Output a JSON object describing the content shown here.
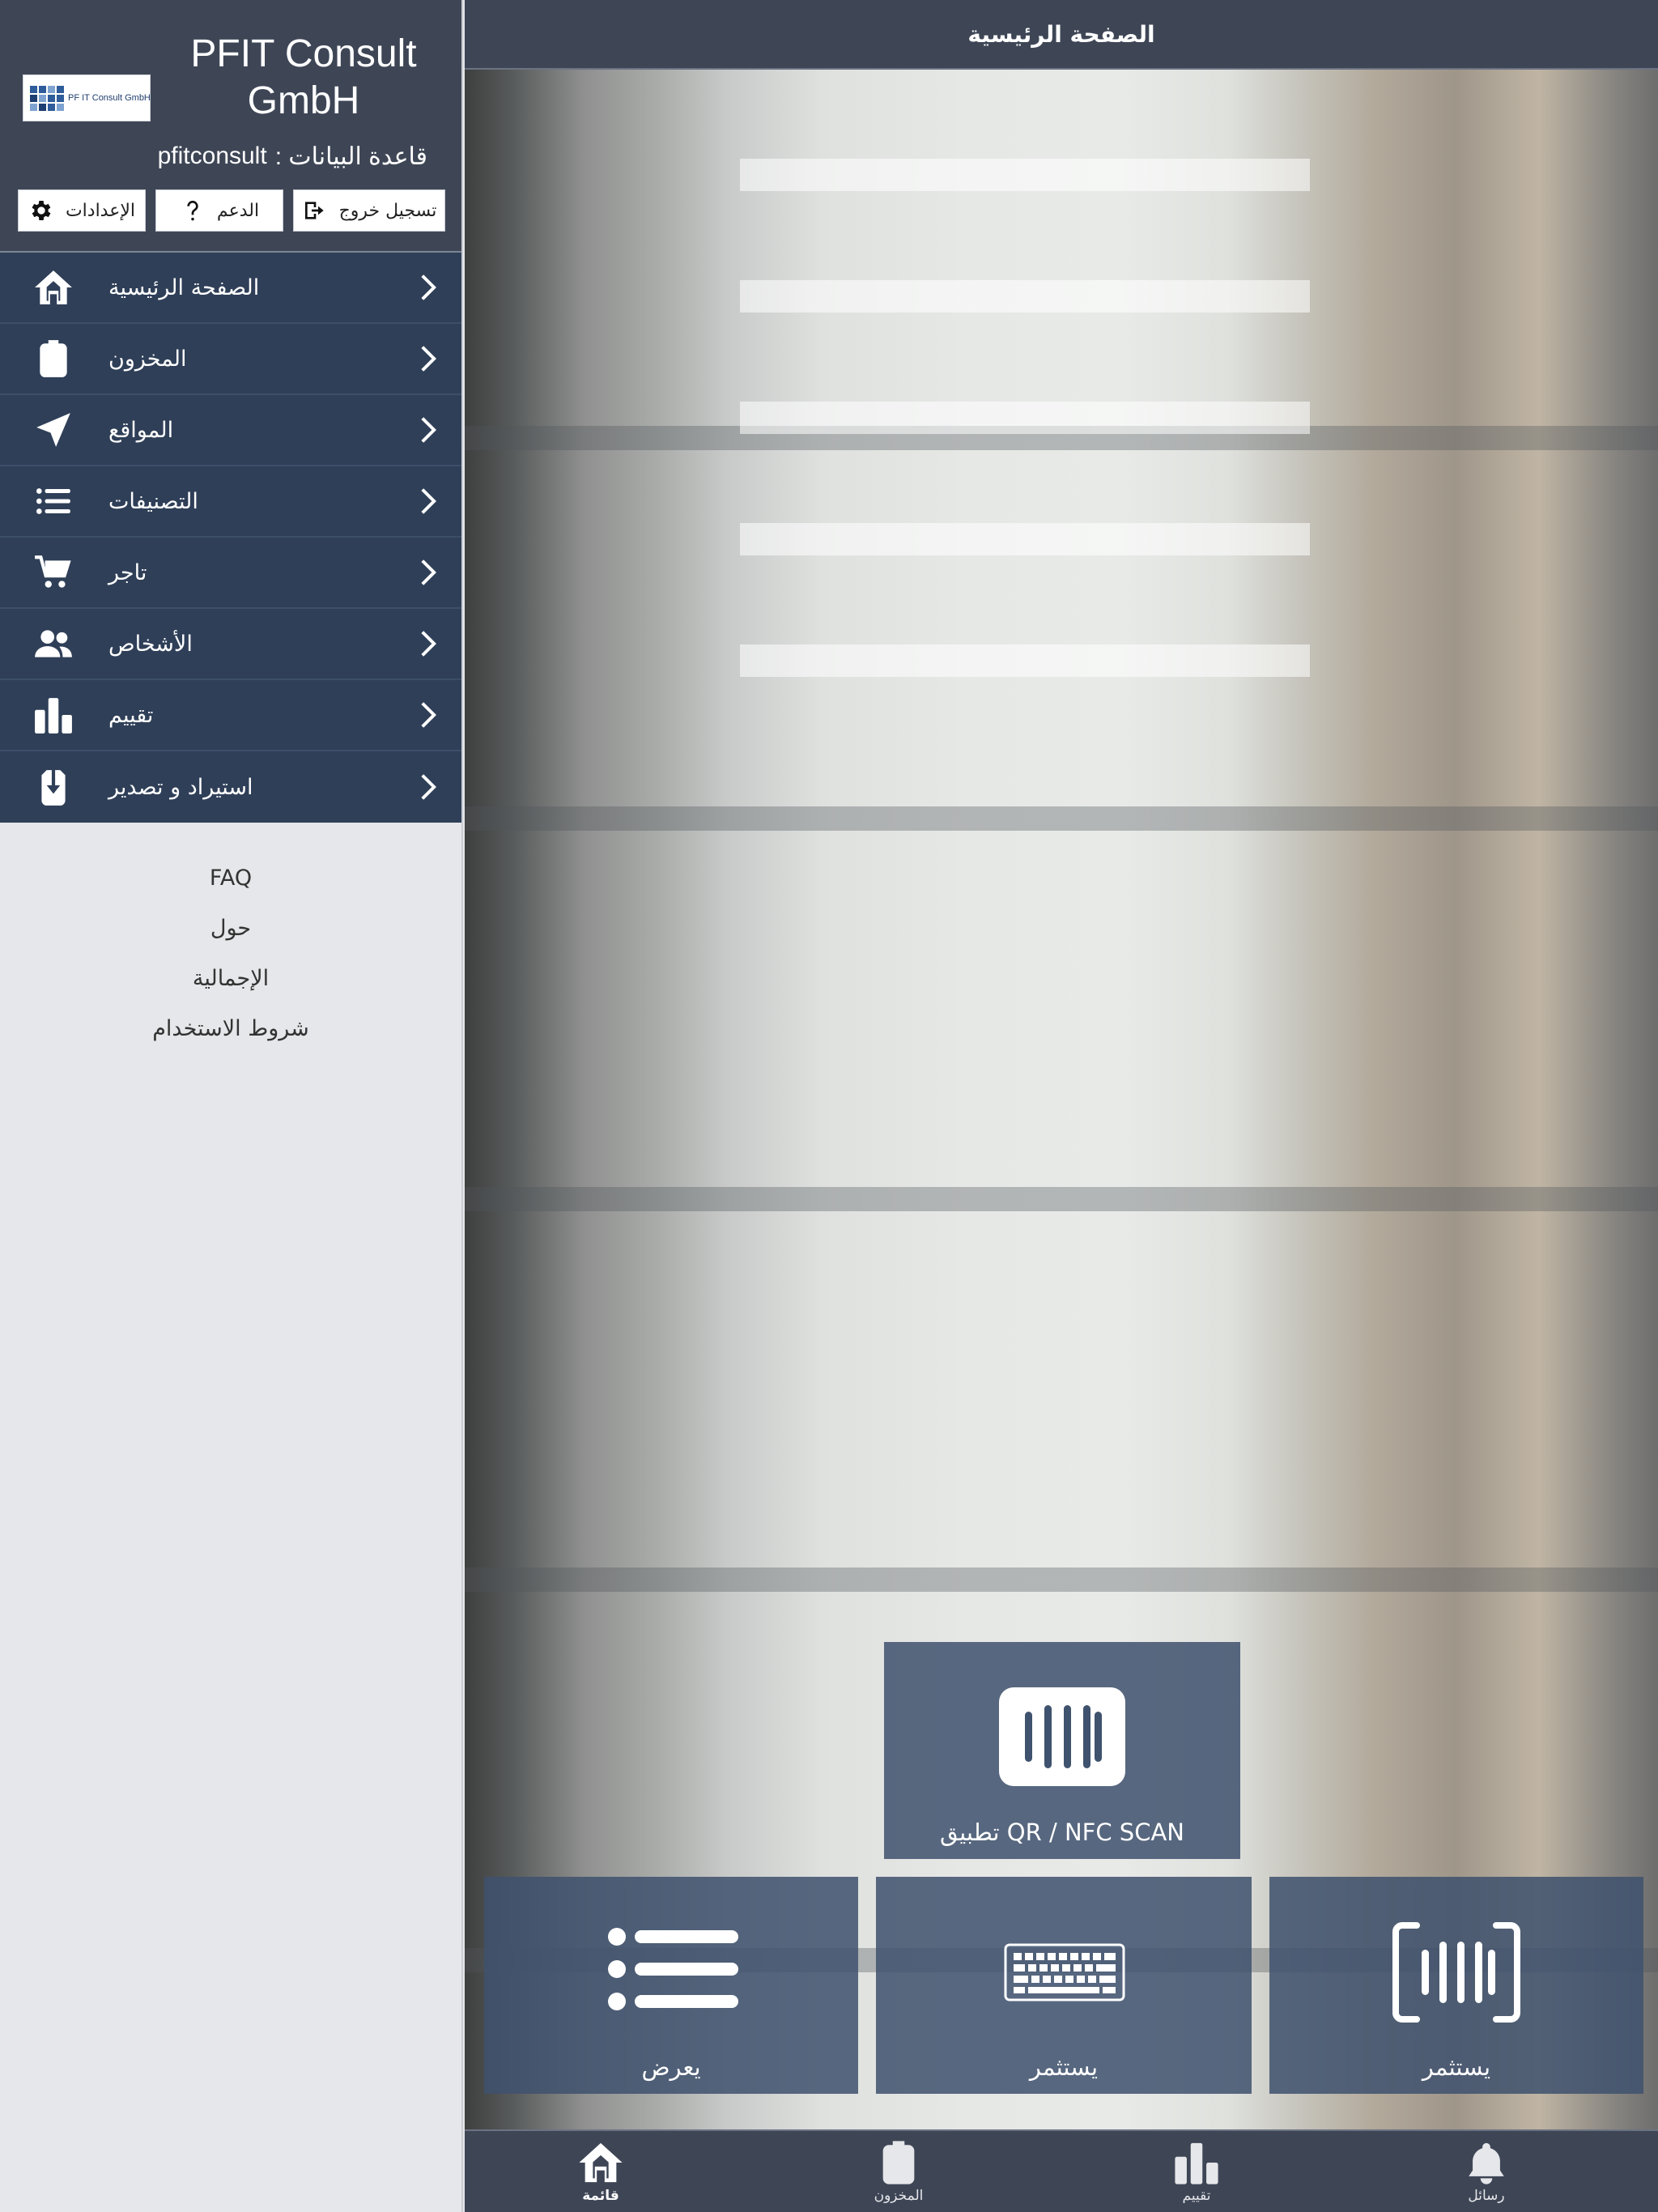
{
  "header": {
    "company_name": "PFIT Consult GmbH",
    "logo_text": "PF IT Consult GmbH",
    "db_label": "قاعدة البيانات :",
    "db_value": "pfitconsult",
    "buttons": {
      "settings": "الإعدادات",
      "support": "الدعم",
      "logout": "تسجيل خروج"
    }
  },
  "nav": {
    "items": [
      {
        "label": "الصفحة الرئيسية",
        "icon": "home-icon"
      },
      {
        "label": "المخزون",
        "icon": "clipboard-icon"
      },
      {
        "label": "المواقع",
        "icon": "location-arrow-icon"
      },
      {
        "label": "التصنيفات",
        "icon": "list-icon"
      },
      {
        "label": "تاجر",
        "icon": "cart-icon"
      },
      {
        "label": "الأشخاص",
        "icon": "people-icon"
      },
      {
        "label": "تقييم",
        "icon": "bar-chart-icon"
      },
      {
        "label": "استيراد و تصدير",
        "icon": "download-icon"
      }
    ]
  },
  "links": {
    "faq": "FAQ",
    "about": "حول",
    "overview": "الإجمالية",
    "terms": "شروط الاستخدام"
  },
  "main": {
    "title": "الصفحة الرئيسية",
    "tiles": {
      "scan_app": "تطبيق QR / NFC SCAN",
      "view": "يعرض",
      "continue_keyboard": "يستثمر",
      "continue_barcode": "يستثمر"
    }
  },
  "tabs": {
    "menu": "قائمة",
    "inventory": "المخزون",
    "rating": "تقييم",
    "messages": "رسائل"
  },
  "colors": {
    "header_bg": "#3e4656",
    "nav_bg": "#2f3f58",
    "tile_bg": "#3f526e",
    "sidebar_bg": "#e6e7ea"
  }
}
